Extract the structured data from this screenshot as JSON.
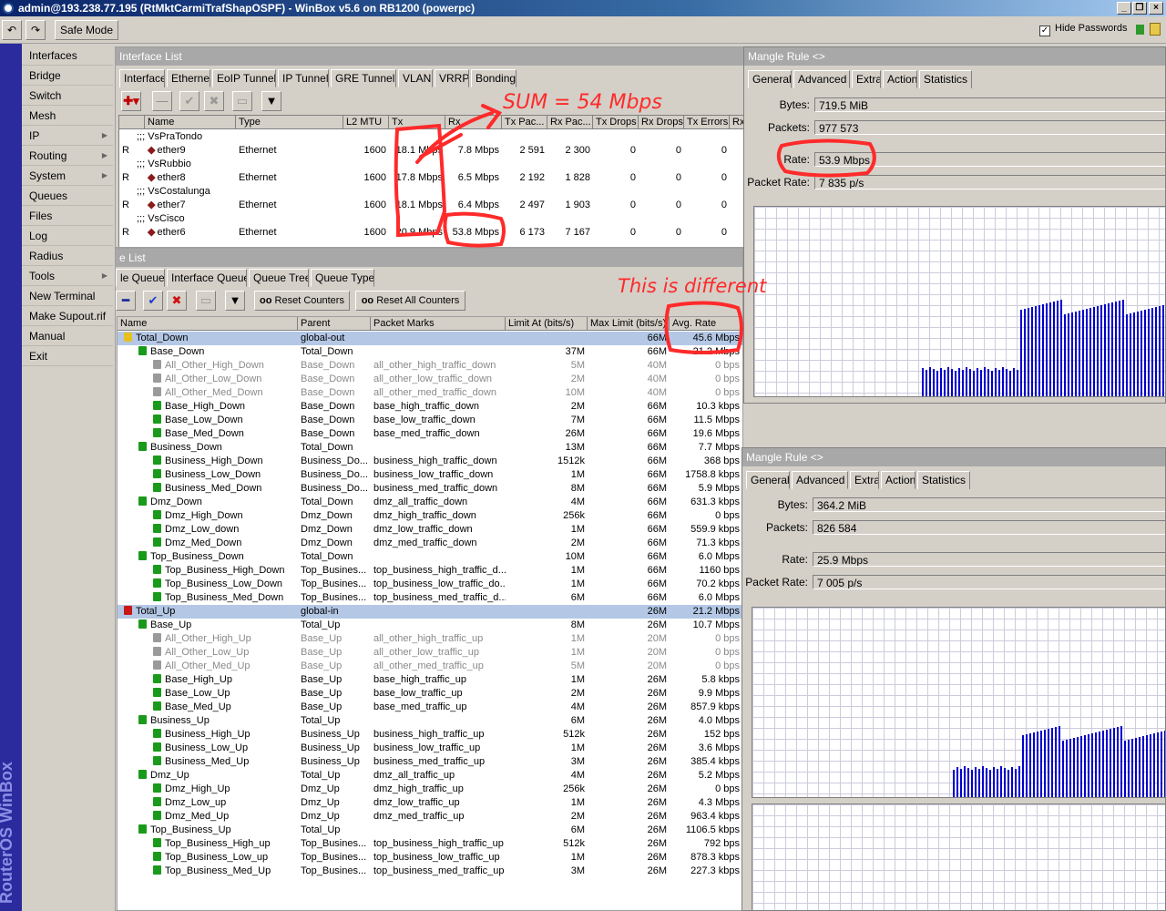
{
  "titlebar": {
    "title": "admin@193.238.77.195 (RtMktCarmiTrafShapOSPF) - WinBox v5.6 on RB1200 (powerpc)"
  },
  "toolbar": {
    "undo": "↶",
    "redo": "↷",
    "safe_mode": "Safe Mode",
    "hide_passwords": "Hide Passwords",
    "check": "✓"
  },
  "brand": "RouterOS WinBox",
  "menu": [
    {
      "label": "Interfaces",
      "sub": false
    },
    {
      "label": "Bridge",
      "sub": false
    },
    {
      "label": "Switch",
      "sub": false
    },
    {
      "label": "Mesh",
      "sub": false
    },
    {
      "label": "IP",
      "sub": true
    },
    {
      "label": "Routing",
      "sub": true
    },
    {
      "label": "System",
      "sub": true
    },
    {
      "label": "Queues",
      "sub": false
    },
    {
      "label": "Files",
      "sub": false
    },
    {
      "label": "Log",
      "sub": false
    },
    {
      "label": "Radius",
      "sub": false
    },
    {
      "label": "Tools",
      "sub": true
    },
    {
      "label": "New Terminal",
      "sub": false
    },
    {
      "label": "Make Supout.rif",
      "sub": false
    },
    {
      "label": "Manual",
      "sub": false
    },
    {
      "label": "Exit",
      "sub": false
    }
  ],
  "iface": {
    "title": "Interface List",
    "tabs": [
      "Interface",
      "Ethernet",
      "EoIP Tunnel",
      "IP Tunnel",
      "GRE Tunnel",
      "VLAN",
      "VRRP",
      "Bonding"
    ],
    "cols": [
      "",
      "Name",
      "Type",
      "L2 MTU",
      "Tx",
      "Rx",
      "Tx Pac...",
      "Rx Pac...",
      "Tx Drops",
      "Rx Drops",
      "Tx Errors",
      "Rx"
    ],
    "rows": [
      {
        "comment": ";;; VsPraTondo"
      },
      {
        "flag": "R",
        "name": "ether9",
        "type": "Ethernet",
        "mtu": "1600",
        "tx": "18.1 Mbps",
        "rx": "7.8 Mbps",
        "txp": "2 591",
        "rxp": "2 300",
        "txd": "0",
        "rxd": "0",
        "txe": "0"
      },
      {
        "comment": ";;; VsRubbio"
      },
      {
        "flag": "R",
        "name": "ether8",
        "type": "Ethernet",
        "mtu": "1600",
        "tx": "17.8 Mbps",
        "rx": "6.5 Mbps",
        "txp": "2 192",
        "rxp": "1 828",
        "txd": "0",
        "rxd": "0",
        "txe": "0"
      },
      {
        "comment": ";;; VsCostalunga"
      },
      {
        "flag": "R",
        "name": "ether7",
        "type": "Ethernet",
        "mtu": "1600",
        "tx": "18.1 Mbps",
        "rx": "6.4 Mbps",
        "txp": "2 497",
        "rxp": "1 903",
        "txd": "0",
        "rxd": "0",
        "txe": "0"
      },
      {
        "comment": ";;; VsCisco"
      },
      {
        "flag": "R",
        "name": "ether6",
        "type": "Ethernet",
        "mtu": "1600",
        "tx": "20.9 Mbps",
        "rx": "53.8 Mbps",
        "txp": "6 173",
        "rxp": "7 167",
        "txd": "0",
        "rxd": "0",
        "txe": "0"
      }
    ]
  },
  "queue": {
    "title": "e List",
    "tabs": [
      "le Queues",
      "Interface Queues",
      "Queue Tree",
      "Queue Types"
    ],
    "reset_counters": "Reset Counters",
    "reset_all": "Reset All Counters",
    "oo": "oo",
    "cols": [
      "Name",
      "Parent",
      "Packet Marks",
      "Limit At (bits/s)",
      "Max Limit (bits/s)",
      "Avg. Rate"
    ],
    "rows": [
      {
        "lvl": 0,
        "c": "y",
        "name": "Total_Down",
        "parent": "global-out",
        "marks": "",
        "limit": "",
        "max": "66M",
        "rate": "45.6 Mbps",
        "sel": true
      },
      {
        "lvl": 1,
        "c": "g",
        "name": "Base_Down",
        "parent": "Total_Down",
        "marks": "",
        "limit": "37M",
        "max": "66M",
        "rate": "21.2 Mbps"
      },
      {
        "lvl": 2,
        "c": "d",
        "name": "All_Other_High_Down",
        "parent": "Base_Down",
        "marks": "all_other_high_traffic_down",
        "limit": "5M",
        "max": "40M",
        "rate": "0 bps"
      },
      {
        "lvl": 2,
        "c": "d",
        "name": "All_Other_Low_Down",
        "parent": "Base_Down",
        "marks": "all_other_low_traffic_down",
        "limit": "2M",
        "max": "40M",
        "rate": "0 bps"
      },
      {
        "lvl": 2,
        "c": "d",
        "name": "All_Other_Med_Down",
        "parent": "Base_Down",
        "marks": "all_other_med_traffic_down",
        "limit": "10M",
        "max": "40M",
        "rate": "0 bps"
      },
      {
        "lvl": 2,
        "c": "g",
        "name": "Base_High_Down",
        "parent": "Base_Down",
        "marks": "base_high_traffic_down",
        "limit": "2M",
        "max": "66M",
        "rate": "10.3 kbps"
      },
      {
        "lvl": 2,
        "c": "g",
        "name": "Base_Low_Down",
        "parent": "Base_Down",
        "marks": "base_low_traffic_down",
        "limit": "7M",
        "max": "66M",
        "rate": "11.5 Mbps"
      },
      {
        "lvl": 2,
        "c": "g",
        "name": "Base_Med_Down",
        "parent": "Base_Down",
        "marks": "base_med_traffic_down",
        "limit": "26M",
        "max": "66M",
        "rate": "19.6 Mbps"
      },
      {
        "lvl": 1,
        "c": "g",
        "name": "Business_Down",
        "parent": "Total_Down",
        "marks": "",
        "limit": "13M",
        "max": "66M",
        "rate": "7.7 Mbps"
      },
      {
        "lvl": 2,
        "c": "g",
        "name": "Business_High_Down",
        "parent": "Business_Do...",
        "marks": "business_high_traffic_down",
        "limit": "1512k",
        "max": "66M",
        "rate": "368 bps"
      },
      {
        "lvl": 2,
        "c": "g",
        "name": "Business_Low_Down",
        "parent": "Business_Do...",
        "marks": "business_low_traffic_down",
        "limit": "1M",
        "max": "66M",
        "rate": "1758.8 kbps"
      },
      {
        "lvl": 2,
        "c": "g",
        "name": "Business_Med_Down",
        "parent": "Business_Do...",
        "marks": "business_med_traffic_down",
        "limit": "8M",
        "max": "66M",
        "rate": "5.9 Mbps"
      },
      {
        "lvl": 1,
        "c": "g",
        "name": "Dmz_Down",
        "parent": "Total_Down",
        "marks": "dmz_all_traffic_down",
        "limit": "4M",
        "max": "66M",
        "rate": "631.3 kbps"
      },
      {
        "lvl": 2,
        "c": "g",
        "name": "Dmz_High_Down",
        "parent": "Dmz_Down",
        "marks": "dmz_high_traffic_down",
        "limit": "256k",
        "max": "66M",
        "rate": "0 bps"
      },
      {
        "lvl": 2,
        "c": "g",
        "name": "Dmz_Low_down",
        "parent": "Dmz_Down",
        "marks": "dmz_low_traffic_down",
        "limit": "1M",
        "max": "66M",
        "rate": "559.9 kbps"
      },
      {
        "lvl": 2,
        "c": "g",
        "name": "Dmz_Med_Down",
        "parent": "Dmz_Down",
        "marks": "dmz_med_traffic_down",
        "limit": "2M",
        "max": "66M",
        "rate": "71.3 kbps"
      },
      {
        "lvl": 1,
        "c": "g",
        "name": "Top_Business_Down",
        "parent": "Total_Down",
        "marks": "",
        "limit": "10M",
        "max": "66M",
        "rate": "6.0 Mbps"
      },
      {
        "lvl": 2,
        "c": "g",
        "name": "Top_Business_High_Down",
        "parent": "Top_Busines...",
        "marks": "top_business_high_traffic_d...",
        "limit": "1M",
        "max": "66M",
        "rate": "1160 bps"
      },
      {
        "lvl": 2,
        "c": "g",
        "name": "Top_Business_Low_Down",
        "parent": "Top_Busines...",
        "marks": "top_business_low_traffic_do...",
        "limit": "1M",
        "max": "66M",
        "rate": "70.2 kbps"
      },
      {
        "lvl": 2,
        "c": "g",
        "name": "Top_Business_Med_Down",
        "parent": "Top_Busines...",
        "marks": "top_business_med_traffic_d...",
        "limit": "6M",
        "max": "66M",
        "rate": "6.0 Mbps"
      },
      {
        "lvl": 0,
        "c": "r",
        "name": "Total_Up",
        "parent": "global-in",
        "marks": "",
        "limit": "",
        "max": "26M",
        "rate": "21.2 Mbps",
        "sel": true
      },
      {
        "lvl": 1,
        "c": "g",
        "name": "Base_Up",
        "parent": "Total_Up",
        "marks": "",
        "limit": "8M",
        "max": "26M",
        "rate": "10.7 Mbps"
      },
      {
        "lvl": 2,
        "c": "d",
        "name": "All_Other_High_Up",
        "parent": "Base_Up",
        "marks": "all_other_high_traffic_up",
        "limit": "1M",
        "max": "20M",
        "rate": "0 bps"
      },
      {
        "lvl": 2,
        "c": "d",
        "name": "All_Other_Low_Up",
        "parent": "Base_Up",
        "marks": "all_other_low_traffic_up",
        "limit": "1M",
        "max": "20M",
        "rate": "0 bps"
      },
      {
        "lvl": 2,
        "c": "d",
        "name": "All_Other_Med_Up",
        "parent": "Base_Up",
        "marks": "all_other_med_traffic_up",
        "limit": "5M",
        "max": "20M",
        "rate": "0 bps"
      },
      {
        "lvl": 2,
        "c": "g",
        "name": "Base_High_Up",
        "parent": "Base_Up",
        "marks": "base_high_traffic_up",
        "limit": "1M",
        "max": "26M",
        "rate": "5.8 kbps"
      },
      {
        "lvl": 2,
        "c": "g",
        "name": "Base_Low_Up",
        "parent": "Base_Up",
        "marks": "base_low_traffic_up",
        "limit": "2M",
        "max": "26M",
        "rate": "9.9 Mbps"
      },
      {
        "lvl": 2,
        "c": "g",
        "name": "Base_Med_Up",
        "parent": "Base_Up",
        "marks": "base_med_traffic_up",
        "limit": "4M",
        "max": "26M",
        "rate": "857.9 kbps"
      },
      {
        "lvl": 1,
        "c": "g",
        "name": "Business_Up",
        "parent": "Total_Up",
        "marks": "",
        "limit": "6M",
        "max": "26M",
        "rate": "4.0 Mbps"
      },
      {
        "lvl": 2,
        "c": "g",
        "name": "Business_High_Up",
        "parent": "Business_Up",
        "marks": "business_high_traffic_up",
        "limit": "512k",
        "max": "26M",
        "rate": "152 bps"
      },
      {
        "lvl": 2,
        "c": "g",
        "name": "Business_Low_Up",
        "parent": "Business_Up",
        "marks": "business_low_traffic_up",
        "limit": "1M",
        "max": "26M",
        "rate": "3.6 Mbps"
      },
      {
        "lvl": 2,
        "c": "g",
        "name": "Business_Med_Up",
        "parent": "Business_Up",
        "marks": "business_med_traffic_up",
        "limit": "3M",
        "max": "26M",
        "rate": "385.4 kbps"
      },
      {
        "lvl": 1,
        "c": "g",
        "name": "Dmz_Up",
        "parent": "Total_Up",
        "marks": "dmz_all_traffic_up",
        "limit": "4M",
        "max": "26M",
        "rate": "5.2 Mbps"
      },
      {
        "lvl": 2,
        "c": "g",
        "name": "Dmz_High_Up",
        "parent": "Dmz_Up",
        "marks": "dmz_high_traffic_up",
        "limit": "256k",
        "max": "26M",
        "rate": "0 bps"
      },
      {
        "lvl": 2,
        "c": "g",
        "name": "Dmz_Low_up",
        "parent": "Dmz_Up",
        "marks": "dmz_low_traffic_up",
        "limit": "1M",
        "max": "26M",
        "rate": "4.3 Mbps"
      },
      {
        "lvl": 2,
        "c": "g",
        "name": "Dmz_Med_Up",
        "parent": "Dmz_Up",
        "marks": "dmz_med_traffic_up",
        "limit": "2M",
        "max": "26M",
        "rate": "963.4 kbps"
      },
      {
        "lvl": 1,
        "c": "g",
        "name": "Top_Business_Up",
        "parent": "Total_Up",
        "marks": "",
        "limit": "6M",
        "max": "26M",
        "rate": "1106.5 kbps"
      },
      {
        "lvl": 2,
        "c": "g",
        "name": "Top_Business_High_up",
        "parent": "Top_Busines...",
        "marks": "top_business_high_traffic_up",
        "limit": "512k",
        "max": "26M",
        "rate": "792 bps"
      },
      {
        "lvl": 2,
        "c": "g",
        "name": "Top_Business_Low_up",
        "parent": "Top_Busines...",
        "marks": "top_business_low_traffic_up",
        "limit": "1M",
        "max": "26M",
        "rate": "878.3 kbps"
      },
      {
        "lvl": 2,
        "c": "g",
        "name": "Top_Business_Med_Up",
        "parent": "Top_Busines...",
        "marks": "top_business_med_traffic_up",
        "limit": "3M",
        "max": "26M",
        "rate": "227.3 kbps"
      }
    ]
  },
  "mangle1": {
    "title": "Mangle Rule <>",
    "tabs": [
      "General",
      "Advanced",
      "Extra",
      "Action",
      "Statistics"
    ],
    "bytes_label": "Bytes:",
    "bytes": "719.5 MiB",
    "packets_label": "Packets:",
    "packets": "977 573",
    "rate_label": "Rate:",
    "rate": "53.9 Mbps",
    "prate_label": "Packet Rate:",
    "prate": "7 835 p/s",
    "legend": "Rate:  53.9 Mbps"
  },
  "mangle2": {
    "title": "Mangle Rule <>",
    "tabs": [
      "General",
      "Advanced",
      "Extra",
      "Action",
      "Statistics"
    ],
    "bytes_label": "Bytes:",
    "bytes": "364.2 MiB",
    "packets_label": "Packets:",
    "packets": "826 584",
    "rate_label": "Rate:",
    "rate": "25.9 Mbps",
    "prate_label": "Packet Rate:",
    "prate": "7 005 p/s",
    "legend": "Rate:  25.9 Mbps"
  },
  "annotations": {
    "sum": "SUM = 54 Mbps",
    "different": "This is different"
  },
  "colors": {
    "accent_red": "#ff2a2a",
    "series": "#0000cc",
    "selected": "#b4c8e6"
  }
}
